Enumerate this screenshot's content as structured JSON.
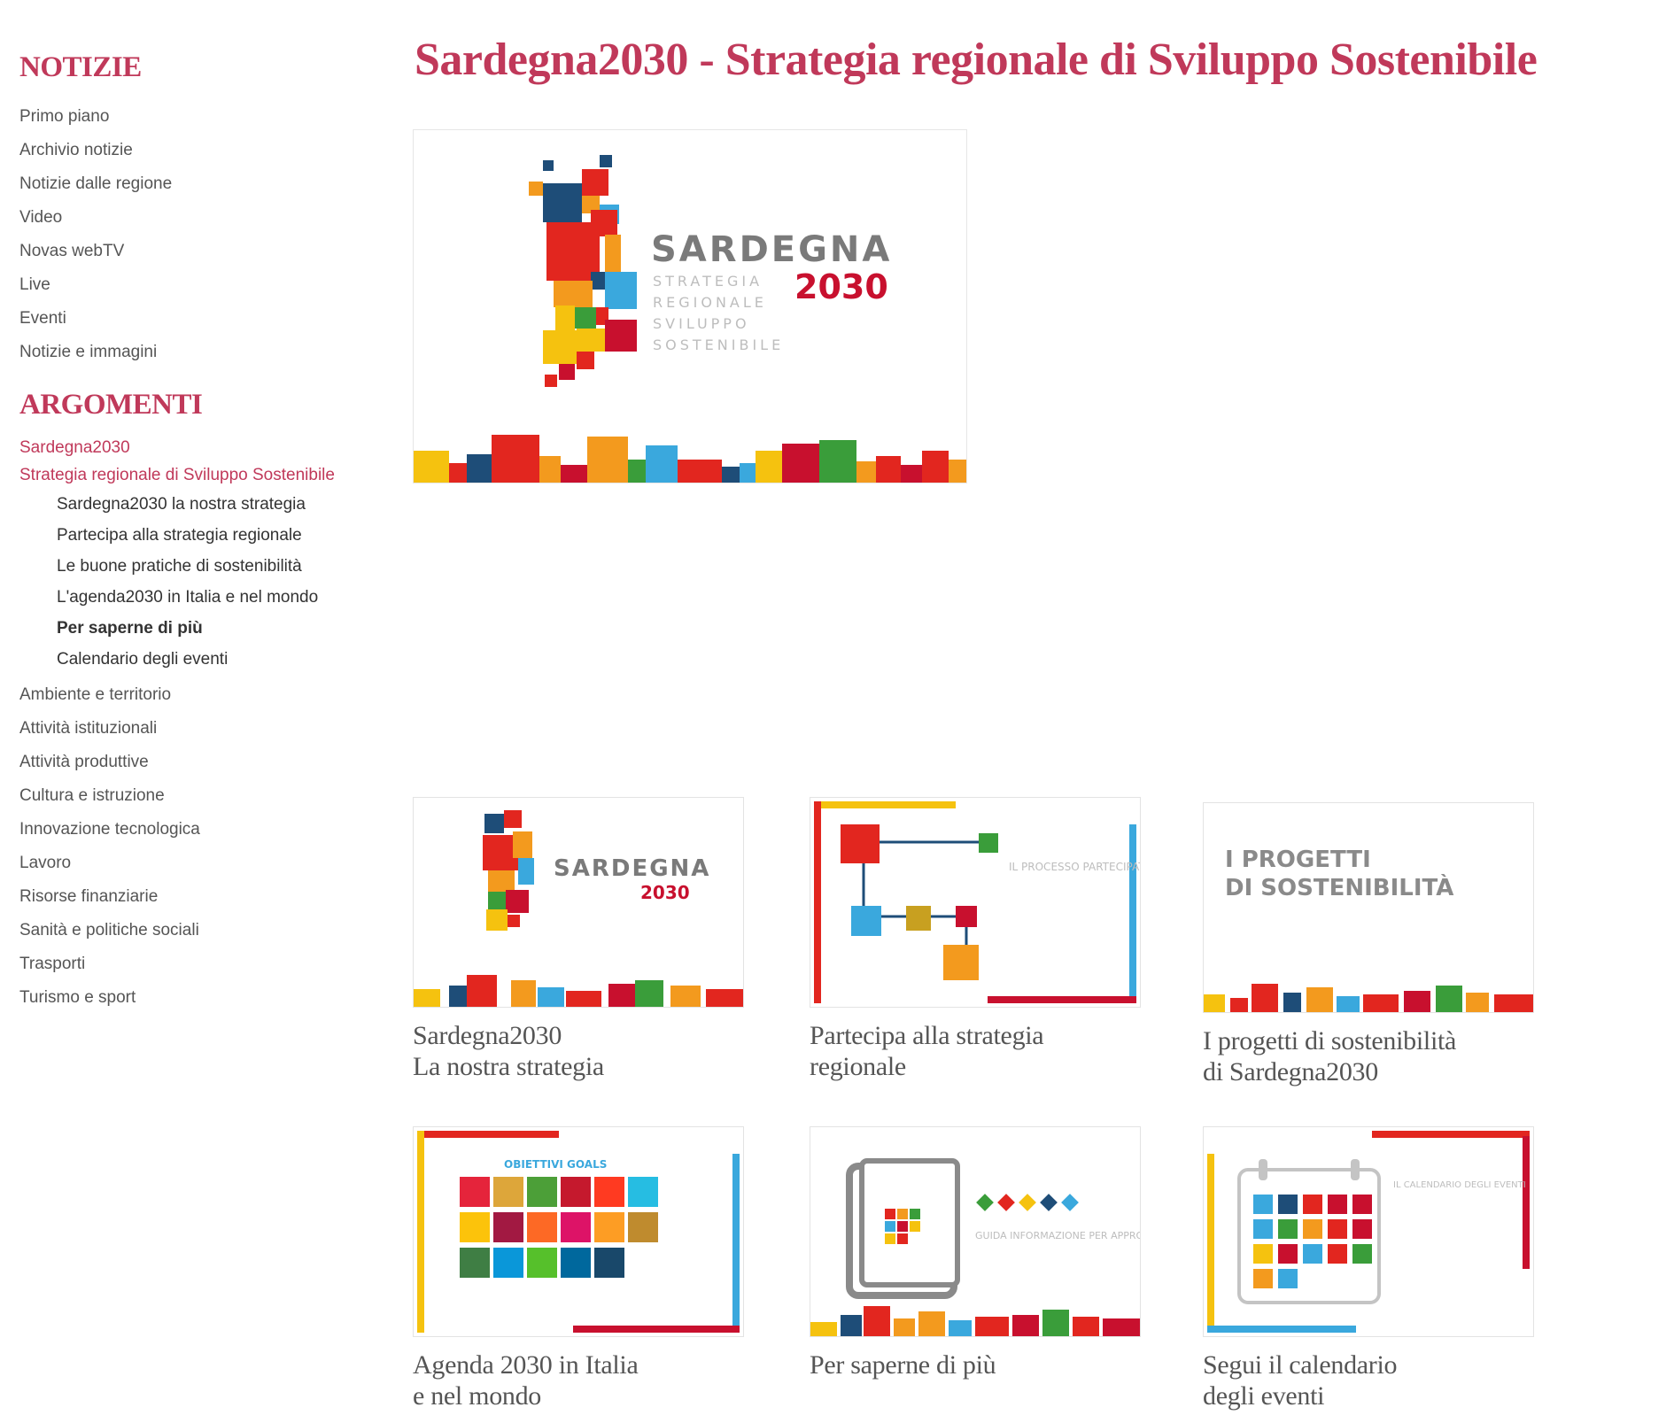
{
  "page": {
    "title": "Sardegna2030 - Strategia regionale di Sviluppo Sostenibile"
  },
  "sidebar": {
    "notizie_title": "NOTIZIE",
    "notizie_items": [
      "Primo piano",
      "Archivio notizie",
      "Notizie dalle regione",
      "Video",
      "Novas webTV",
      "Live",
      "Eventi",
      "Notizie e immagini"
    ],
    "argomenti_title": "ARGOMENTI",
    "active_items": [
      "Sardegna2030",
      "Strategia regionale di Sviluppo Sostenibile"
    ],
    "sub_items": [
      "Sardegna2030 la nostra strategia",
      "Partecipa alla strategia regionale",
      "Le buone pratiche di sostenibilità",
      "L'agenda2030 in Italia e nel mondo",
      "Per saperne di più",
      "Calendario degli eventi"
    ],
    "argomenti_items": [
      "Ambiente e territorio",
      "Attività istituzionali",
      "Attività produttive",
      "Cultura e istruzione",
      "Innovazione tecnologica",
      "Lavoro",
      "Risorse finanziarie",
      "Sanità e politiche sociali",
      "Trasporti",
      "Turismo e sport"
    ]
  },
  "hero_logo": {
    "word": "SARDEGNA",
    "year": "2030",
    "lines": [
      "STRATEGIA",
      "REGIONALE",
      "SVILUPPO",
      "SOSTENIBILE"
    ]
  },
  "cards": [
    {
      "caption": "Sardegna2030\nLa nostra strategia",
      "thumb": {
        "word": "SARDEGNA",
        "year": "2030"
      }
    },
    {
      "caption": "Partecipa alla strategia\nregionale",
      "thumb": {
        "text": "IL PROCESSO PARTECIPATIVO"
      }
    },
    {
      "caption": "I progetti di sostenibilità\ndi Sardegna2030",
      "thumb": {
        "line1": "I PROGETTI",
        "line2": "DI SOSTENIBILITÀ"
      }
    },
    {
      "caption": "Agenda 2030 in Italia\ne nel mondo",
      "thumb": {
        "text": "OBIETTIVI GOALS"
      }
    },
    {
      "caption": "Per saperne di più",
      "thumb": {
        "text": "GUIDA INFORMAZIONE PER APPROFONDIRE"
      }
    },
    {
      "caption": "Segui il calendario\ndegli eventi",
      "thumb": {
        "text": "IL CALENDARIO DEGLI EVENTI"
      }
    }
  ],
  "colors": {
    "accent": "#c0395a",
    "red": "#e2261f",
    "orange": "#f39a1e",
    "yellow": "#f5c20f",
    "blue": "#3aa8dd",
    "navy": "#1e4d78",
    "green": "#3a9d3a",
    "crimson": "#c8102e"
  }
}
